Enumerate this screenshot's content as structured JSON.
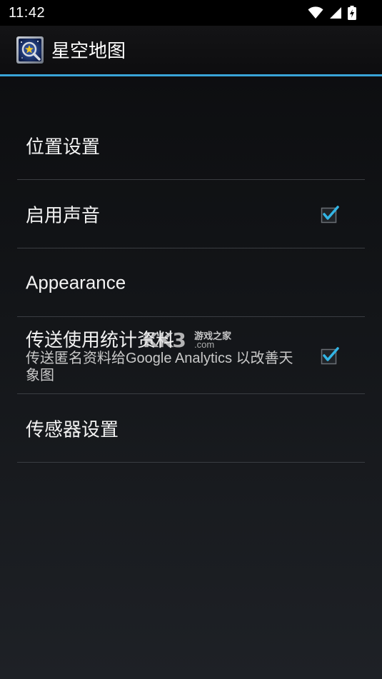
{
  "status_bar": {
    "time": "11:42",
    "icons": [
      "wifi-icon",
      "cellular-signal-icon",
      "battery-charging-icon"
    ]
  },
  "action_bar": {
    "title": "星空地图",
    "icon": "sky-map-app-icon",
    "accent_color": "#39a4d8"
  },
  "preferences": [
    {
      "title": "位置设置",
      "summary": "",
      "has_checkbox": false
    },
    {
      "title": "启用声音",
      "summary": "",
      "has_checkbox": true,
      "checked": true
    },
    {
      "title": "Appearance",
      "summary": "",
      "has_checkbox": false
    },
    {
      "title": "传送使用统计资料",
      "summary": "传送匿名资料给Google Analytics 以改善天象图",
      "has_checkbox": true,
      "checked": true
    },
    {
      "title": "传感器设置",
      "summary": "",
      "has_checkbox": false
    }
  ],
  "watermark": {
    "logo": "KK3",
    "cn": "游戏之家",
    "domain": ".com"
  }
}
